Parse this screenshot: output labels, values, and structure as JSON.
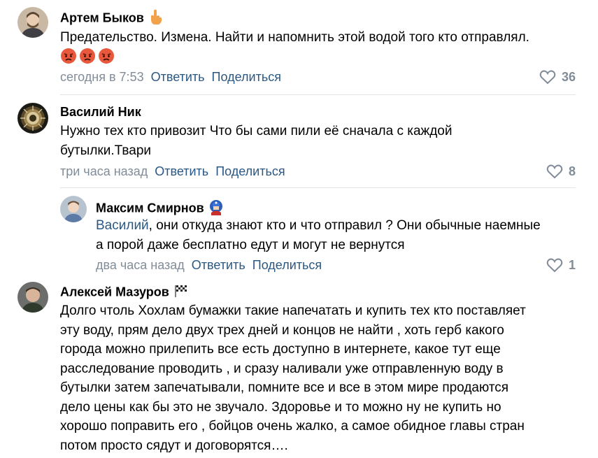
{
  "comments": [
    {
      "author": "Артем Быков",
      "text": "Предательство. Измена. Найти и напомнить этой водой того кто отправлял.",
      "time": "сегодня в 7:53",
      "reply": "Ответить",
      "share": "Поделиться",
      "likes": "36",
      "emoji": [
        "angry-face",
        "angry-face",
        "angry-face"
      ]
    },
    {
      "author": "Василий Ник",
      "text_line1": "Нужно тех кто привозит Что бы сами пили её сначала с каждой",
      "text_line2": "бутылки.Твари",
      "time": "три часа назад",
      "reply": "Ответить",
      "share": "Поделиться",
      "likes": "8"
    },
    {
      "author": "Максим Смирнов",
      "mention": "Василий",
      "text_line1": ", они откуда знают кто и что отправил ? Они обычные наемные",
      "text_line2": "а порой даже бесплатно едут и могут не вернутся",
      "time": "два часа назад",
      "reply": "Ответить",
      "share": "Поделиться",
      "likes": "1"
    },
    {
      "author": "Алексей Мазуров",
      "lines": [
        "Долго чтоль Хохлам бумажки такие напечатать и купить тех кто поставляет",
        "эту воду, прям дело двух трех дней и концов не найти , хоть герб какого",
        "города можно прилепить все есть доступно в интернете, какое тут еще",
        "расследование проводить , и сразу наливали уже отправленную воду в",
        "бутылки затем запечатывали, помните все и все в этом мире продаются",
        "дело цены как бы это не звучало. Здоровье и то можно ну не купить но",
        "хорошо поправить его , бойцов очень жалко, а самое обидное главы стран",
        "потом просто сядут и договорятся…."
      ]
    }
  ],
  "colors": {
    "link": "#2a5885",
    "muted": "#818c99",
    "divider": "#e1e3e6"
  }
}
